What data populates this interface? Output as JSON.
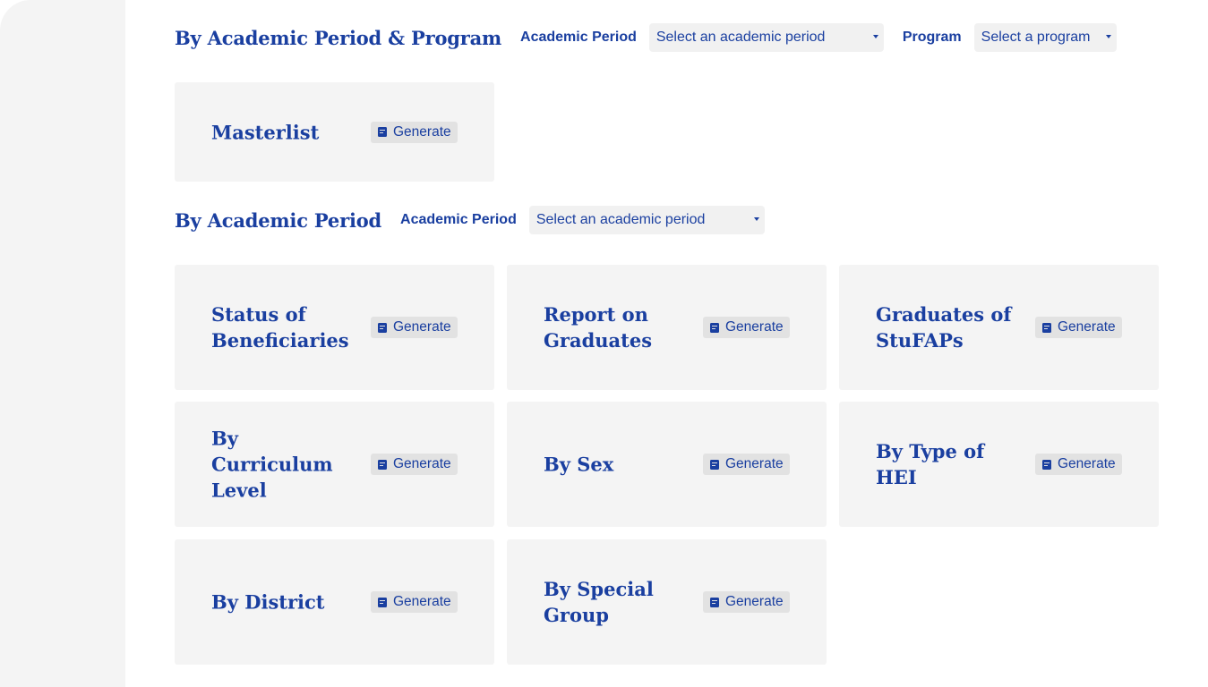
{
  "section1": {
    "title": "By Academic Period & Program",
    "period_label": "Academic Period",
    "period_placeholder": "Select an academic period",
    "program_label": "Program",
    "program_placeholder": "Select a program"
  },
  "section2": {
    "title": "By Academic Period",
    "period_label": "Academic Period",
    "period_placeholder": "Select an academic period"
  },
  "generate_label": "Generate",
  "cards": {
    "masterlist": "Masterlist",
    "status_of_beneficiaries": "Status of Beneficiaries",
    "report_on_graduates": "Report on Graduates",
    "graduates_of_stufaps": "Graduates of StuFAPs",
    "by_curriculum_level": "By Curriculum Level",
    "by_sex": "By Sex",
    "by_type_of_hei": "By Type of HEI",
    "by_district": "By District",
    "by_special_group": "By Special Group"
  },
  "icons": {
    "generate": "document-icon",
    "dropdown": "caret-down-icon"
  },
  "colors": {
    "accent": "#1a3fa0",
    "card_bg": "#f4f4f4",
    "button_bg": "#e2e2e2"
  }
}
